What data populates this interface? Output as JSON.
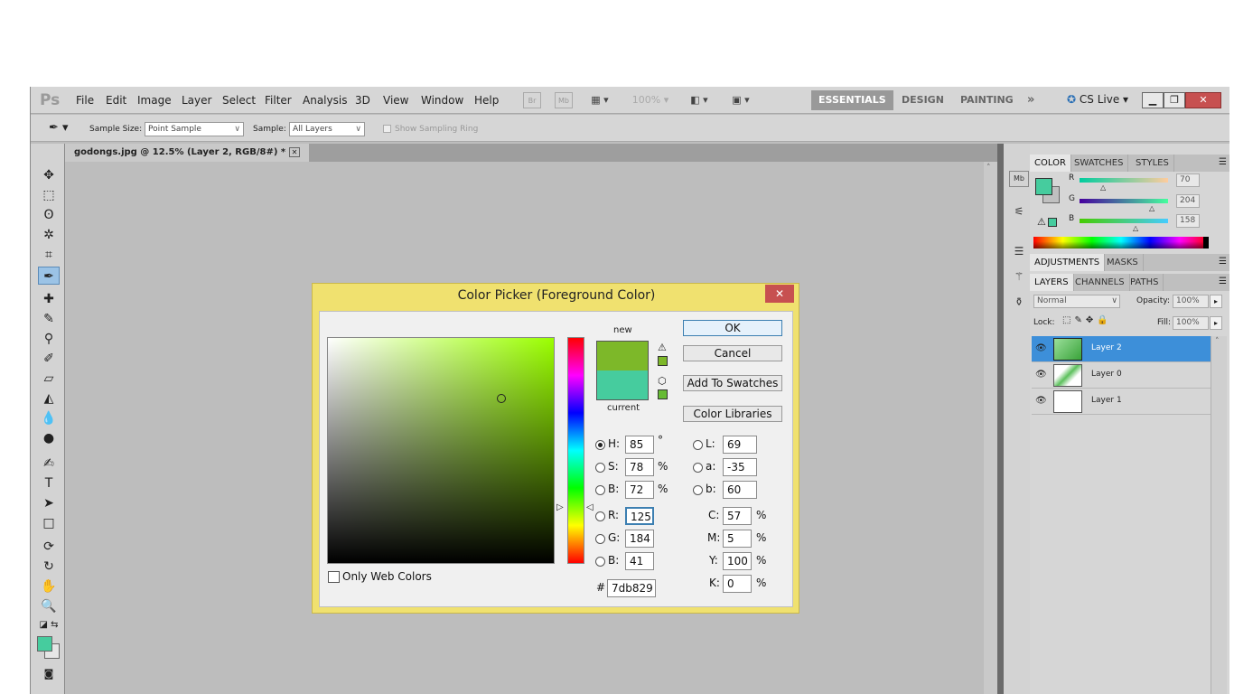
{
  "menubar": {
    "logo": "Ps",
    "menus": [
      "File",
      "Edit",
      "Image",
      "Layer",
      "Select",
      "Filter",
      "Analysis",
      "3D",
      "View",
      "Window",
      "Help"
    ],
    "br_label": "Br",
    "mb_label": "Mb",
    "zoom": "100%",
    "workspaces": [
      "ESSENTIALS",
      "DESIGN",
      "PAINTING"
    ],
    "more": "»",
    "cslive": "CS Live"
  },
  "options": {
    "sample_size_label": "Sample Size:",
    "sample_size_value": "Point Sample",
    "sample_label": "Sample:",
    "sample_value": "All Layers",
    "show_ring": "Show Sampling Ring"
  },
  "document": {
    "tab_title": "godongs.jpg @ 12.5% (Layer 2, RGB/8#) *"
  },
  "color_panel": {
    "tabs": [
      "COLOR",
      "SWATCHES",
      "STYLES"
    ],
    "r_label": "R",
    "g_label": "G",
    "b_label": "B",
    "r_value": "70",
    "g_value": "204",
    "b_value": "158",
    "fg_color": "#46cc9e"
  },
  "adjust_panel": {
    "tabs": [
      "ADJUSTMENTS",
      "MASKS"
    ]
  },
  "layers_panel": {
    "tabs": [
      "LAYERS",
      "CHANNELS",
      "PATHS"
    ],
    "blend_mode": "Normal",
    "opacity_label": "Opacity:",
    "opacity": "100%",
    "lock_label": "Lock:",
    "fill_label": "Fill:",
    "fill": "100%",
    "layers": [
      {
        "name": "Layer 2"
      },
      {
        "name": "Layer 0"
      },
      {
        "name": "Layer 1"
      }
    ]
  },
  "dialog": {
    "title": "Color Picker (Foreground Color)",
    "close": "✕",
    "new_label": "new",
    "current_label": "current",
    "new_color": "#7db829",
    "current_color": "#46cc9e",
    "ok": "OK",
    "cancel": "Cancel",
    "add_swatches": "Add To Swatches",
    "libraries": "Color Libraries",
    "only_web": "Only Web Colors",
    "hsb": {
      "h": "85",
      "s": "78",
      "b": "72"
    },
    "rgb": {
      "r": "125",
      "g": "184",
      "b": "41"
    },
    "lab": {
      "l": "69",
      "a": "-35",
      "b": "60"
    },
    "cmyk": {
      "c": "57",
      "m": "5",
      "y": "100",
      "k": "0"
    },
    "hex": "7db829",
    "labels": {
      "h": "H:",
      "s": "S:",
      "b": "B:",
      "r": "R:",
      "g": "G:",
      "b2": "B:",
      "l": "L:",
      "a": "a:",
      "bb": "b:",
      "c": "C:",
      "m": "M:",
      "y": "Y:",
      "k": "K:",
      "hash": "#"
    },
    "units": {
      "deg": "°",
      "pct": "%"
    }
  }
}
